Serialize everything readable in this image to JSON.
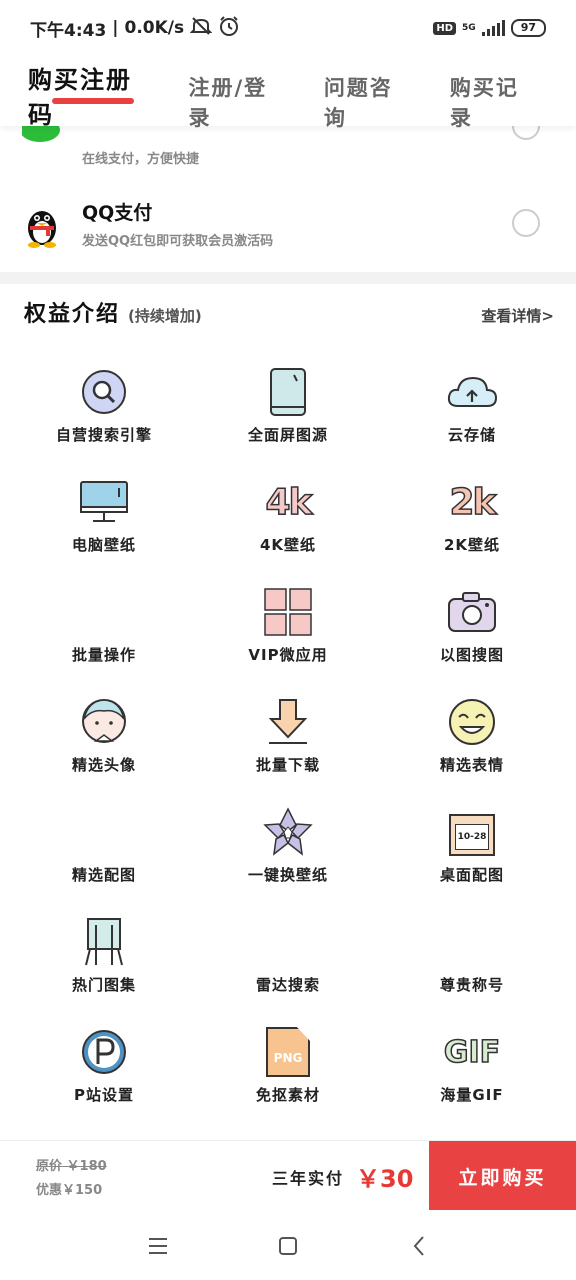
{
  "status_bar": {
    "time": "下午4:43",
    "speed": "0.0K/s",
    "hd": "HD",
    "network": "5G",
    "battery": "97"
  },
  "tabs": [
    {
      "label": "购买注册码",
      "active": true
    },
    {
      "label": "注册/登录",
      "active": false
    },
    {
      "label": "问题咨询",
      "active": false
    },
    {
      "label": "购买记录",
      "active": false
    }
  ],
  "payment": {
    "wechat": {
      "subtitle": "在线支付，方便快捷"
    },
    "qq": {
      "title": "QQ支付",
      "subtitle": "发送QQ红包即可获取会员激活码"
    }
  },
  "benefits": {
    "title": "权益介绍",
    "subtitle": "(持续增加)",
    "detail_link": "查看详情>",
    "items": [
      {
        "label": "自营搜索引擎",
        "icon": "search-icon"
      },
      {
        "label": "全面屏图源",
        "icon": "phone-icon"
      },
      {
        "label": "云存储",
        "icon": "cloud-upload-icon"
      },
      {
        "label": "电脑壁纸",
        "icon": "monitor-icon"
      },
      {
        "label": "4K壁纸",
        "icon": "4k-icon"
      },
      {
        "label": "2K壁纸",
        "icon": "2k-icon"
      },
      {
        "label": "批量操作",
        "icon": "batch-icon"
      },
      {
        "label": "VIP微应用",
        "icon": "apps-grid-icon"
      },
      {
        "label": "以图搜图",
        "icon": "camera-icon"
      },
      {
        "label": "精选头像",
        "icon": "avatar-icon"
      },
      {
        "label": "批量下载",
        "icon": "download-icon"
      },
      {
        "label": "精选表情",
        "icon": "emoji-icon"
      },
      {
        "label": "精选配图",
        "icon": "image-icon"
      },
      {
        "label": "一键换壁纸",
        "icon": "flower-icon"
      },
      {
        "label": "桌面配图",
        "icon": "calendar-icon"
      },
      {
        "label": "热门图集",
        "icon": "easel-icon"
      },
      {
        "label": "雷达搜索",
        "icon": "radar-icon"
      },
      {
        "label": "尊贵称号",
        "icon": "badge-icon"
      },
      {
        "label": "P站设置",
        "icon": "pixiv-icon"
      },
      {
        "label": "免抠素材",
        "icon": "png-file-icon"
      },
      {
        "label": "海量GIF",
        "icon": "gif-icon"
      }
    ],
    "calendar_text": "10-28",
    "png_text": "PNG",
    "gif_text": "GIF",
    "k4_text": "4k",
    "k2_text": "2k"
  },
  "purchase": {
    "original_price": "原价 ￥180",
    "discount_price": "优惠￥150",
    "term": "三年实付",
    "price": "￥30",
    "buy_label": "立即购买"
  },
  "colors": {
    "accent": "#e94242",
    "price": "#e53935",
    "wechat_green": "#2bbd3a"
  }
}
